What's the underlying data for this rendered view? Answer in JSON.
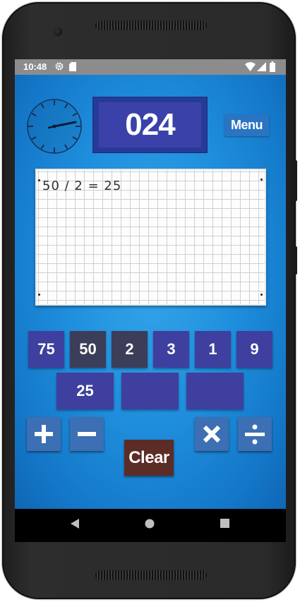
{
  "status_bar": {
    "time": "10:48"
  },
  "game": {
    "target": "024",
    "menu_label": "Menu",
    "work_line": "50 / 2 = 25",
    "number_tiles": [
      {
        "value": "75",
        "used": false
      },
      {
        "value": "50",
        "used": true
      },
      {
        "value": "2",
        "used": true
      },
      {
        "value": "3",
        "used": false
      },
      {
        "value": "1",
        "used": false
      },
      {
        "value": "9",
        "used": false
      }
    ],
    "result_tiles": [
      "25",
      "",
      ""
    ],
    "clear_label": "Clear",
    "operators": [
      "add",
      "subtract",
      "multiply",
      "divide"
    ]
  },
  "colors": {
    "background": "#1f8fdd",
    "tile": "#3e3f9e",
    "tile_used": "#3c3d58",
    "operator": "#3c6fb3",
    "clear": "#5c2c27",
    "target_box": "#3a42aa"
  },
  "icons": [
    "settings-icon",
    "sd-card-icon",
    "wifi-icon",
    "signal-icon",
    "battery-icon",
    "back-icon",
    "home-icon",
    "recents-icon"
  ]
}
